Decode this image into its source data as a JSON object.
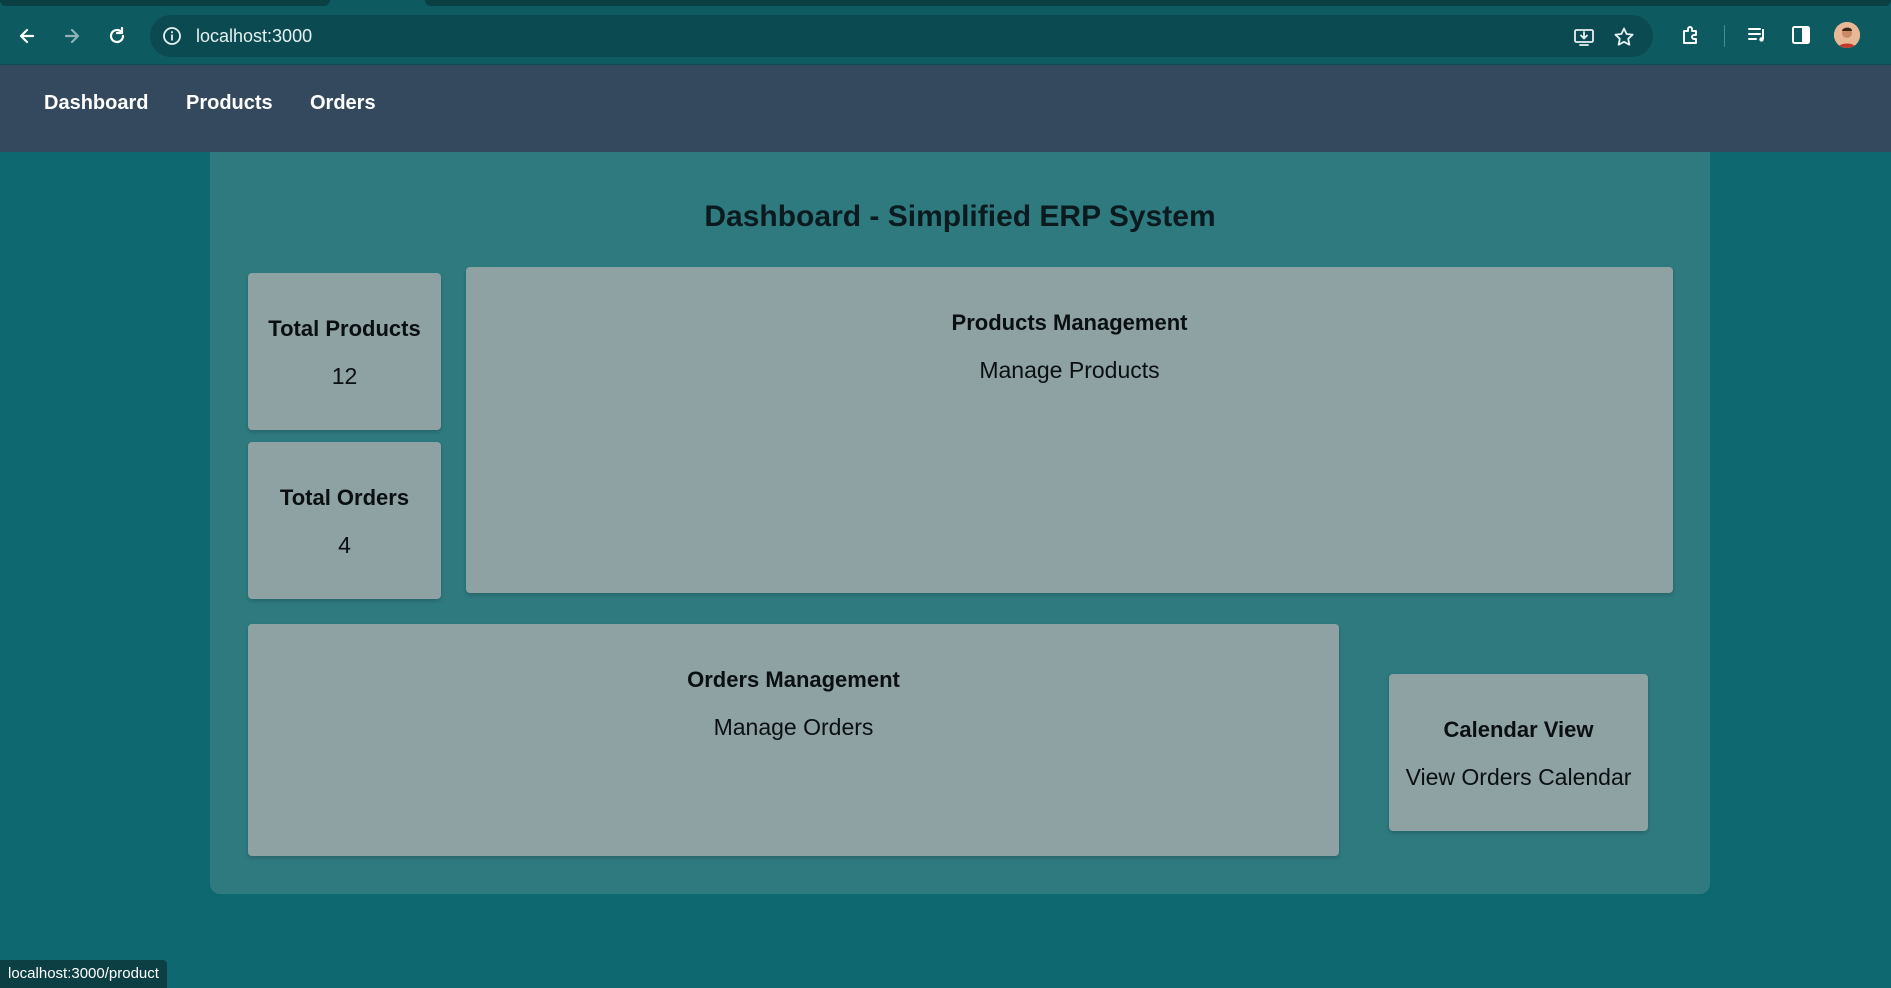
{
  "browser": {
    "url": "localhost:3000",
    "status_url": "localhost:3000/product"
  },
  "nav": {
    "items": [
      {
        "label": "Dashboard"
      },
      {
        "label": "Products"
      },
      {
        "label": "Orders"
      }
    ]
  },
  "dashboard": {
    "title": "Dashboard - Simplified ERP System",
    "total_products": {
      "label": "Total Products",
      "value": "12"
    },
    "total_orders": {
      "label": "Total Orders",
      "value": "4"
    },
    "products_management": {
      "title": "Products Management",
      "link": "Manage Products"
    },
    "orders_management": {
      "title": "Orders Management",
      "link": "Manage Orders"
    },
    "calendar_view": {
      "title": "Calendar View",
      "link": "View Orders Calendar"
    }
  },
  "colors": {
    "page_bg": "#0e6870",
    "nav_bg": "#35495e",
    "panel_bg": "#2e7a7f",
    "card_bg": "#8ea1a3"
  },
  "icons": [
    "back-arrow-icon",
    "forward-arrow-icon",
    "reload-icon",
    "info-icon",
    "install-app-icon",
    "star-icon",
    "extensions-icon",
    "media-controls-icon",
    "side-panel-icon",
    "profile-avatar-icon"
  ]
}
